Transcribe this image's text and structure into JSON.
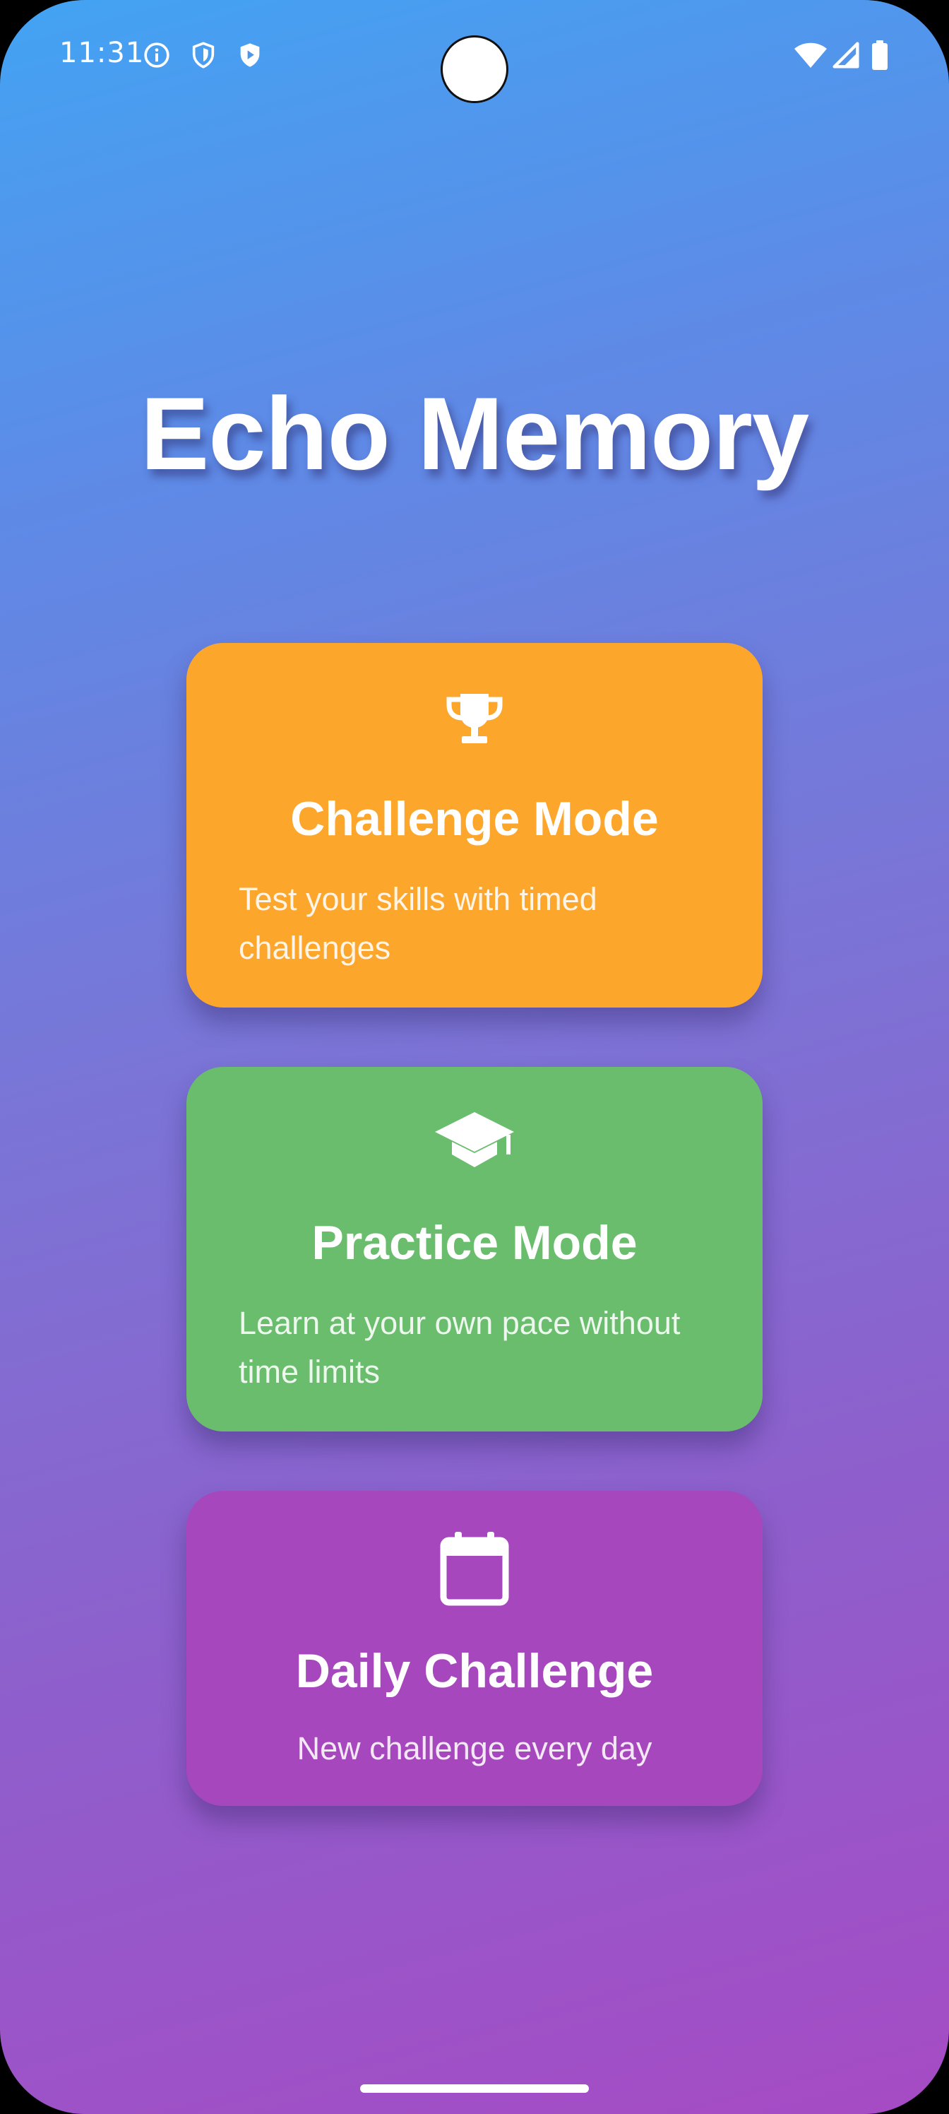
{
  "status_bar": {
    "time": "11:31",
    "left_icons": [
      "info-icon",
      "shield-icon",
      "play-shield-icon"
    ],
    "right_icons": [
      "wifi-icon",
      "cellular-signal-icon",
      "battery-icon"
    ]
  },
  "app": {
    "title": "Echo Memory"
  },
  "modes": [
    {
      "title": "Challenge Mode",
      "description": "Test your skills with timed challenges",
      "icon": "trophy-icon",
      "color": "#fca62c"
    },
    {
      "title": "Practice Mode",
      "description": "Learn at your own pace without time limits",
      "icon": "graduation-cap-icon",
      "color": "#69bd6d"
    },
    {
      "title": "Daily Challenge",
      "description": "New challenge every day",
      "icon": "calendar-icon",
      "color": "#a747bd"
    }
  ],
  "colors": {
    "gradient_top": "#43a3f3",
    "gradient_bottom": "#a64bc4"
  }
}
